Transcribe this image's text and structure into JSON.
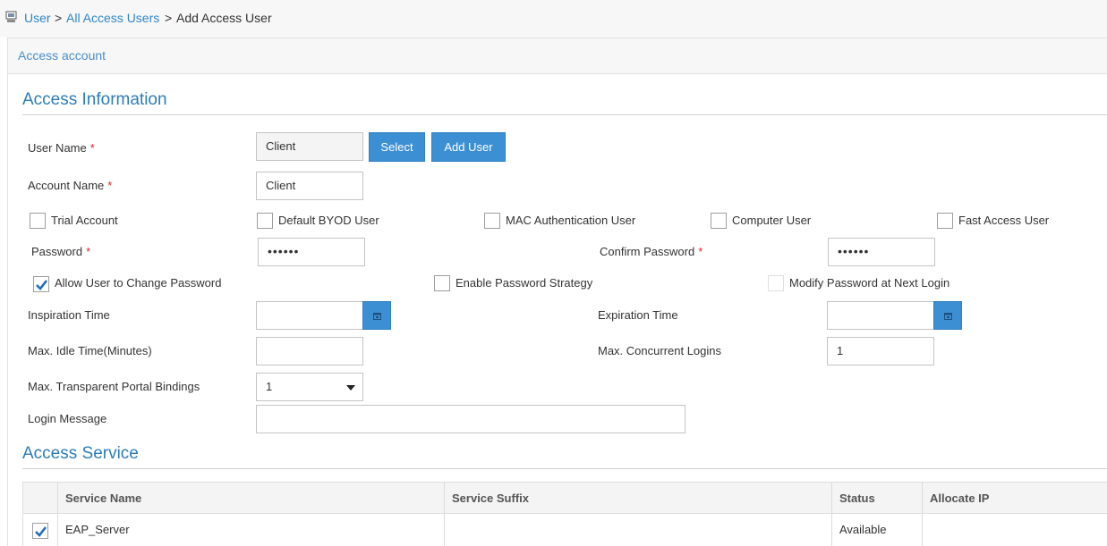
{
  "breadcrumb": {
    "root": "User",
    "sep1": ">",
    "parent": "All Access Users",
    "sep2": ">",
    "current": "Add Access User"
  },
  "panel": {
    "title": "Access account"
  },
  "access_information": {
    "title": "Access Information",
    "user_name": {
      "label": "User Name",
      "required": "*",
      "value": "Client",
      "select_button": "Select",
      "add_user_button": "Add User"
    },
    "account_name": {
      "label": "Account Name",
      "required": "*",
      "value": "Client"
    },
    "checkboxes": {
      "trial_account": {
        "label": "Trial Account",
        "checked": false
      },
      "default_byod": {
        "label": "Default BYOD User",
        "checked": false
      },
      "mac_auth": {
        "label": "MAC Authentication User",
        "checked": false
      },
      "computer_user": {
        "label": "Computer User",
        "checked": false
      },
      "fast_access": {
        "label": "Fast Access User",
        "checked": false
      }
    },
    "password": {
      "label": "Password",
      "required": "*",
      "value": "••••••"
    },
    "confirm_password": {
      "label": "Confirm Password",
      "required": "*",
      "value": "••••••"
    },
    "allow_change_password": {
      "label": "Allow User to Change Password",
      "checked": true
    },
    "enable_password_strategy": {
      "label": "Enable Password Strategy",
      "checked": false
    },
    "modify_password_next_login": {
      "label": "Modify Password at Next Login",
      "checked": false
    },
    "inspiration_time": {
      "label": "Inspiration Time",
      "value": ""
    },
    "expiration_time": {
      "label": "Expiration Time",
      "value": ""
    },
    "max_idle_time": {
      "label": "Max. Idle Time(Minutes)",
      "value": ""
    },
    "max_concurrent_logins": {
      "label": "Max. Concurrent Logins",
      "value": "1"
    },
    "max_portal_bindings": {
      "label": "Max. Transparent Portal Bindings",
      "value": "1"
    },
    "login_message": {
      "label": "Login Message",
      "value": ""
    }
  },
  "access_service": {
    "title": "Access Service",
    "columns": [
      "Service Name",
      "Service Suffix",
      "Status",
      "Allocate IP"
    ],
    "rows": [
      {
        "checked": true,
        "service_name": "EAP_Server",
        "service_suffix": "",
        "status": "Available",
        "allocate_ip": ""
      }
    ]
  },
  "colors": {
    "accent": "#3d8fd4",
    "title": "#2d7db8",
    "required": "#d9262c"
  },
  "icons": {
    "breadcrumb": "user-admin-icon",
    "calendar": "calendar-icon",
    "check": "checkmark-icon",
    "dropdown": "caret-down-icon"
  }
}
